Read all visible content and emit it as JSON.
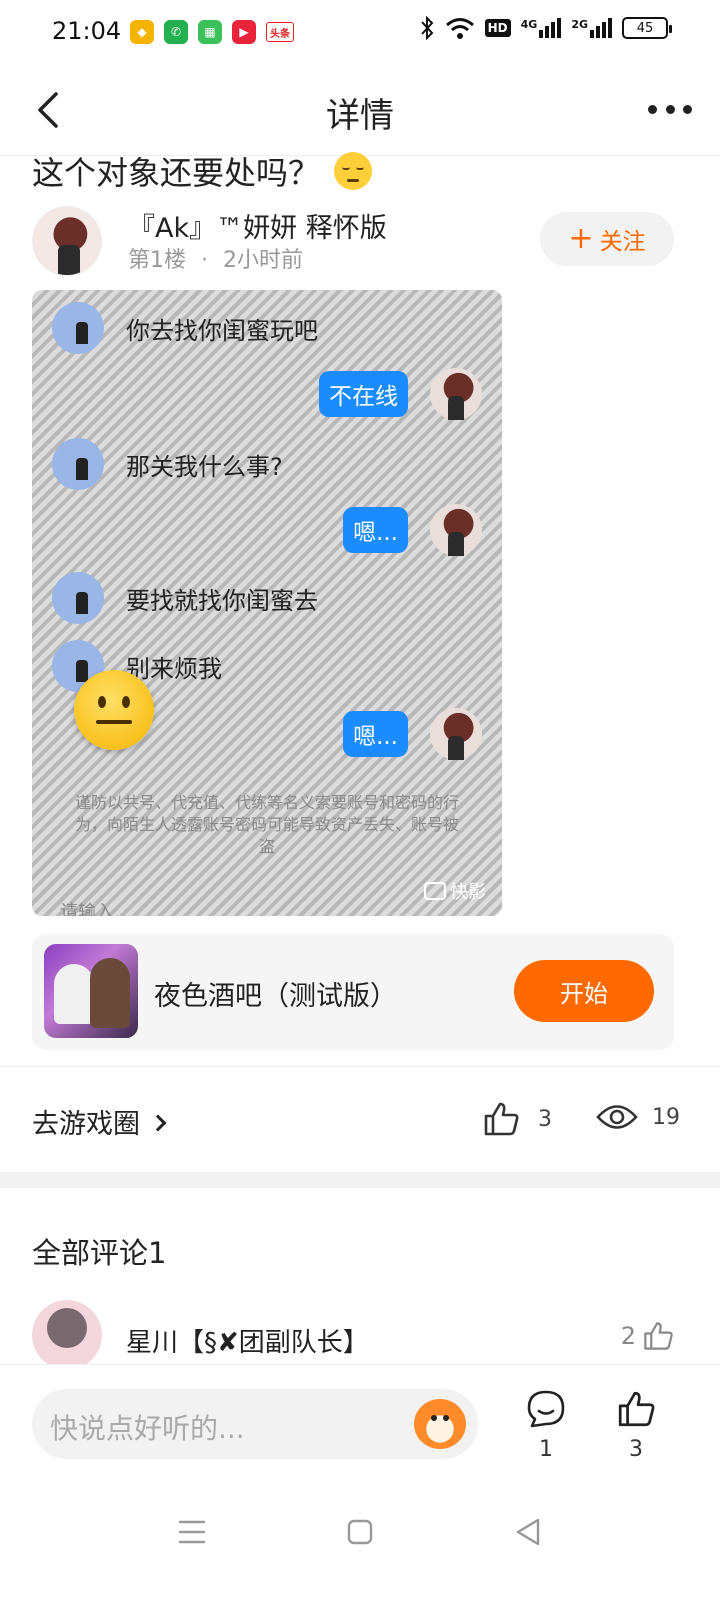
{
  "status_bar": {
    "time": "21:04",
    "network_1": "4G",
    "network_2": "2G",
    "hd_label": "HD",
    "battery": "45",
    "app_icons": [
      "wallet-icon",
      "phone-icon",
      "app-store-icon",
      "video-icon",
      "toutiao-icon"
    ],
    "toutiao_label": "头条"
  },
  "header": {
    "title": "详情"
  },
  "post": {
    "title": "这个对象还要处吗？",
    "author_name": "『Ak』™妍妍 释怀版",
    "floor": "第1楼",
    "separator": "·",
    "time_ago": "2小时前",
    "follow_label": "关注",
    "image": {
      "messages": [
        {
          "side": "left",
          "text": "你去找你闺蜜玩吧"
        },
        {
          "side": "right",
          "text": "不在线"
        },
        {
          "side": "left",
          "text": "那关我什么事?"
        },
        {
          "side": "right",
          "text": "嗯..."
        },
        {
          "side": "left",
          "text": "要找就找你闺蜜去"
        },
        {
          "side": "left",
          "text": "别来烦我"
        },
        {
          "side": "right",
          "text": "嗯..."
        }
      ],
      "warning": "谨防以共号、代充值、代练等名义索要账号和密码的行为，向陌生人透露账号密码可能导致资产丢失、账号被盗",
      "watermark": "快影",
      "input_hint": "请输入..."
    }
  },
  "game_card": {
    "name": "夜色酒吧（测试版）",
    "start_label": "开始"
  },
  "actions": {
    "goto_circle_label": "去游戏圈",
    "likes": "3",
    "views": "19"
  },
  "comments": {
    "header": "全部评论1",
    "items": [
      {
        "author": "星川【§✘团副队长】",
        "likes": "2"
      }
    ]
  },
  "bottom_bar": {
    "input_placeholder": "快说点好听的...",
    "comment_count": "1",
    "like_count": "3"
  },
  "colors": {
    "accent": "#ff6a00",
    "chat_bubble": "#1a8cff"
  }
}
